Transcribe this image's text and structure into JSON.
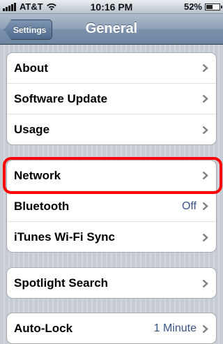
{
  "status_bar": {
    "carrier": "AT&T",
    "time": "10:16 PM",
    "battery": "52%",
    "battery_level": 0.52,
    "icons": [
      "signal-icon",
      "wifi-icon",
      "battery-icon"
    ]
  },
  "nav": {
    "title": "General",
    "back_label": "Settings"
  },
  "groups": [
    {
      "rows": [
        {
          "label": "About"
        },
        {
          "label": "Software Update"
        },
        {
          "label": "Usage"
        }
      ]
    },
    {
      "rows": [
        {
          "label": "Network"
        },
        {
          "label": "Bluetooth",
          "value": "Off"
        },
        {
          "label": "iTunes Wi-Fi Sync"
        }
      ]
    },
    {
      "rows": [
        {
          "label": "Spotlight Search"
        }
      ]
    },
    {
      "rows": [
        {
          "label": "Auto-Lock",
          "value": "1 Minute"
        }
      ]
    }
  ],
  "colors": {
    "highlight": "#ff0000",
    "value_text": "#385487",
    "nav_bar": "#7c92ac"
  }
}
